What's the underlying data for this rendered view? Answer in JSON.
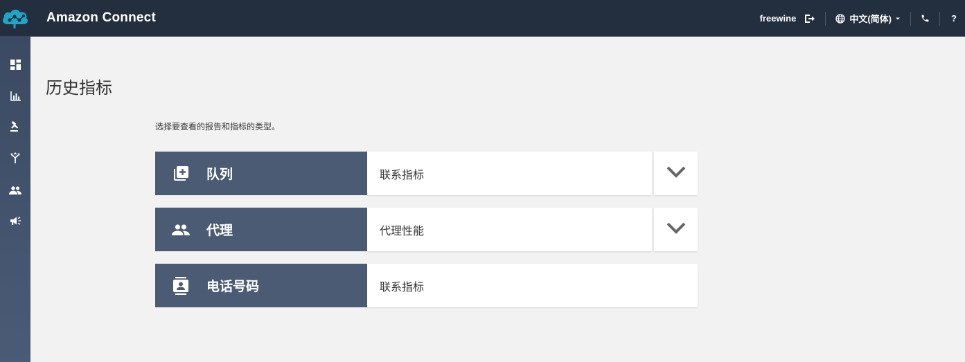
{
  "app": {
    "title": "Amazon Connect",
    "brand_color": "#1fa6c6"
  },
  "topbar": {
    "username": "freewine",
    "language": "中文(简体)",
    "help_label": "?",
    "bg_color": "#232f3e"
  },
  "sidebar": {
    "items": [
      {
        "icon": "dashboard-icon"
      },
      {
        "icon": "bar-chart-icon"
      },
      {
        "icon": "gavel-icon"
      },
      {
        "icon": "routing-icon"
      },
      {
        "icon": "users-icon"
      },
      {
        "icon": "megaphone-icon"
      }
    ]
  },
  "page": {
    "title": "历史指标",
    "subtitle": "选择要查看的报告和指标的类型。"
  },
  "reports": [
    {
      "label": "队列",
      "icon": "add-to-queue-icon",
      "selected": "联系指标",
      "has_dropdown": true
    },
    {
      "label": "代理",
      "icon": "people-icon",
      "selected": "代理性能",
      "has_dropdown": true
    },
    {
      "label": "电话号码",
      "icon": "contact-card-icon",
      "selected": "联系指标",
      "has_dropdown": false
    }
  ]
}
